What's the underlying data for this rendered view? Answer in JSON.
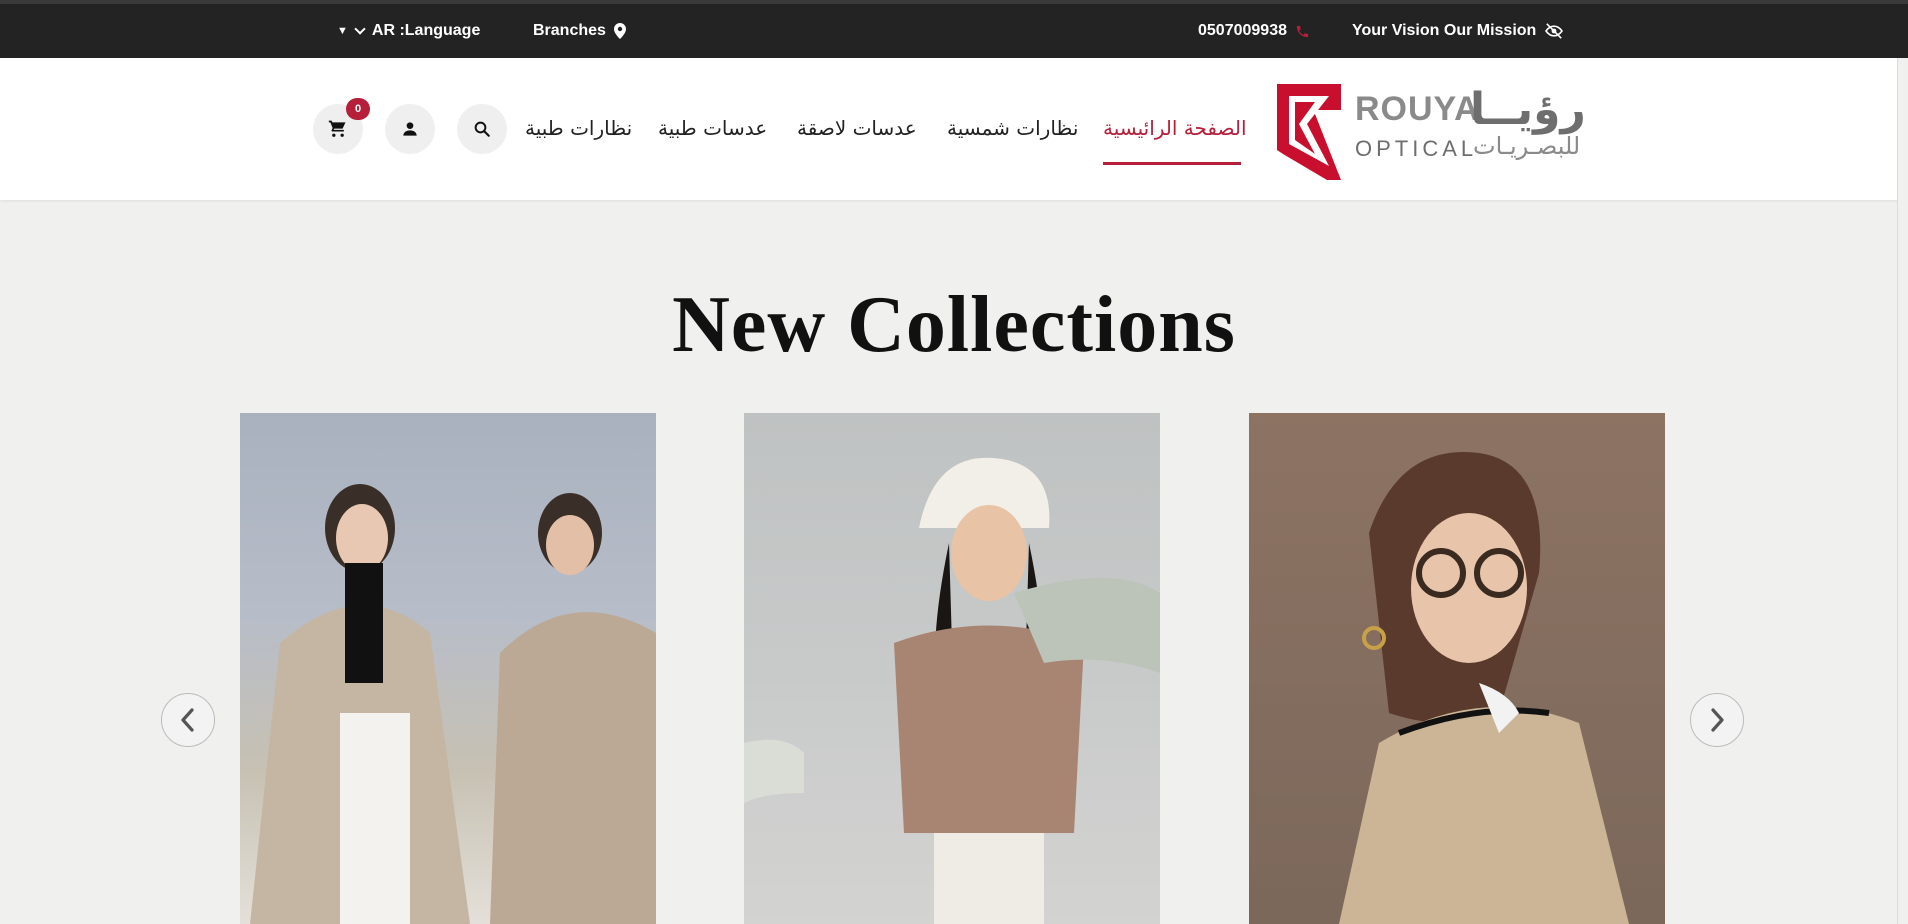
{
  "topbar": {
    "language_label": "AR  :Language",
    "branches_label": "Branches",
    "phone": "0507009938",
    "mission": "Your Vision Our Mission"
  },
  "logo": {
    "latin_top": "ROUYA",
    "arabic_top": "رؤيــا",
    "latin_bottom": "OPTICAL",
    "arabic_bottom": "للبصـريـات"
  },
  "nav": {
    "items": [
      {
        "label": "الصفحة الرائيسية",
        "active": true
      },
      {
        "label": "نظارات شمسية"
      },
      {
        "label": "عدسات لاصقة"
      },
      {
        "label": "عدسات طبية"
      },
      {
        "label": "نظارات طبية"
      }
    ]
  },
  "cart": {
    "count": "0"
  },
  "colors": {
    "accent": "#b51f3a",
    "topbar_bg": "#232323",
    "page_bg": "#f0f0ef"
  },
  "main": {
    "title": "New Collections",
    "cards": [
      {
        "icon": "model-photo-coats"
      },
      {
        "icon": "model-photo-bucket-hat"
      },
      {
        "icon": "model-photo-glasses"
      }
    ]
  }
}
